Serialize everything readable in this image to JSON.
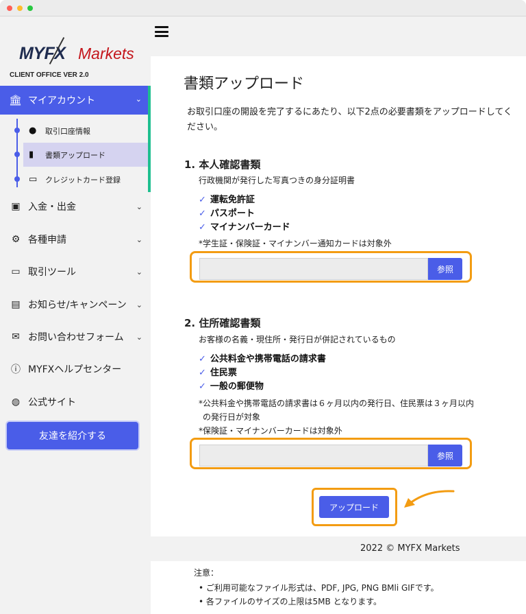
{
  "brand": {
    "logo_part1": "MYFX",
    "logo_part2": "Markets",
    "version": "CLIENT OFFICE VER 2.0"
  },
  "sidebar": {
    "active_menu": {
      "label": "マイアカウント",
      "icon": "bank-icon"
    },
    "sub_items": [
      {
        "label": "取引口座情報",
        "icon": "user-icon"
      },
      {
        "label": "書類アップロード",
        "icon": "document-icon"
      },
      {
        "label": "クレジットカード登録",
        "icon": "credit-card-icon"
      }
    ],
    "items": [
      {
        "label": "入金・出金",
        "icon": "money-icon",
        "has_chevron": true
      },
      {
        "label": "各種申請",
        "icon": "gears-icon",
        "has_chevron": true
      },
      {
        "label": "取引ツール",
        "icon": "laptop-icon",
        "has_chevron": true
      },
      {
        "label": "お知らせ/キャンペーン",
        "icon": "newspaper-icon",
        "has_chevron": true
      },
      {
        "label": "お問い合わせフォーム",
        "icon": "envelope-icon",
        "has_chevron": true
      },
      {
        "label": "MYFXヘルプセンター",
        "icon": "info-icon",
        "has_chevron": false
      },
      {
        "label": "公式サイト",
        "icon": "globe-icon",
        "has_chevron": false
      }
    ],
    "refer_button": "友達を紹介する"
  },
  "main": {
    "title": "書類アップロード",
    "intro": "お取引口座の開設を完了するにあたり、以下2点の必要書類をアップロードしてください。",
    "section1": {
      "title": "1. 本人確認書類",
      "subtitle": "行政機関が発行した写真つきの身分証明書",
      "items": [
        "運転免許証",
        "パスポート",
        "マイナンバーカード"
      ],
      "note": "*学生証・保険証・マイナンバー通知カードは対象外",
      "browse_label": "参照"
    },
    "section2": {
      "title": "2. 住所確認書類",
      "subtitle": "お客様の名義・現住所・発行日が併記されているもの",
      "items": [
        "公共料金や携帯電話の請求書",
        "住民票",
        "一般の郵便物"
      ],
      "note1_line1": "*公共料金や携帯電話の請求書は６ヶ月以内の発行日、住民票は３ヶ月以内",
      "note1_line2": "の発行日が対象",
      "note2": "*保険証・マイナンバーカードは対象外",
      "browse_label": "参照"
    },
    "upload_button": "アップロード"
  },
  "footer": {
    "copyright": "2022 © MYFX Markets",
    "notes_title": "注意：",
    "notes": [
      "ご利用可能なファイル形式は、PDF, JPG, PNG BMli GIFです。",
      "各ファイルのサイズの上限は5MB となります。"
    ]
  },
  "colors": {
    "accent": "#4a5de8",
    "highlight": "#f39c12",
    "active_border": "#1fbf8f",
    "sidebar_bg": "#f2f2f2"
  }
}
